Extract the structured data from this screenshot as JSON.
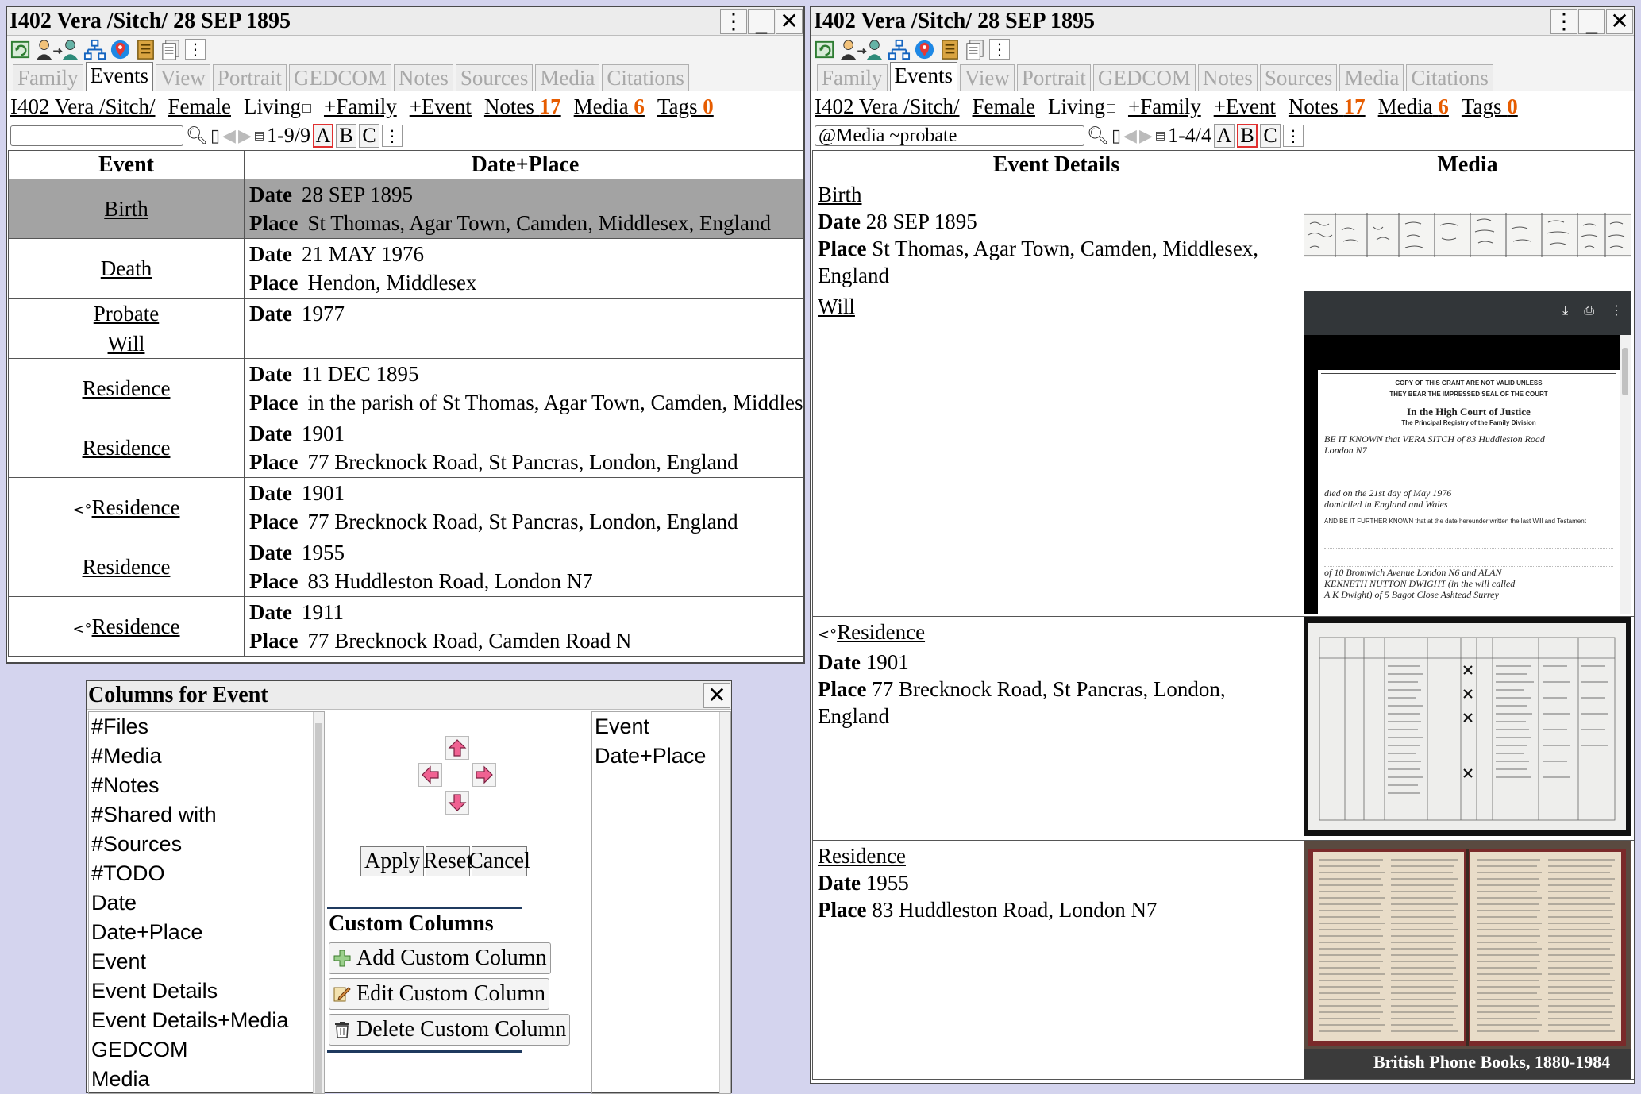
{
  "left": {
    "title": "I402 Vera /Sitch/ 28 SEP 1895",
    "tabs": [
      "Family",
      "Events",
      "View",
      "Portrait",
      "GEDCOM",
      "Notes",
      "Sources",
      "Media",
      "Citations"
    ],
    "info": {
      "name": "I402 Vera /Sitch/",
      "sex": "Female",
      "living": "Living",
      "add_family": "+Family",
      "add_event": "+Event",
      "notes_label": "Notes",
      "notes_count": "17",
      "media_label": "Media",
      "media_count": "6",
      "tags_label": "Tags",
      "tags_count": "0"
    },
    "search": {
      "value": "",
      "range": "1-9/9"
    },
    "columns": [
      "Event",
      "Date+Place"
    ],
    "rows": [
      {
        "event": "Birth",
        "shared": false,
        "date": "28 SEP 1895",
        "place": "St Thomas, Agar Town, Camden, Middlesex, England"
      },
      {
        "event": "Death",
        "shared": false,
        "date": "21 MAY 1976",
        "place": "Hendon, Middlesex"
      },
      {
        "event": "Probate",
        "shared": false,
        "date": "1977",
        "place": ""
      },
      {
        "event": "Will",
        "shared": false,
        "date": "",
        "place": ""
      },
      {
        "event": "Residence",
        "shared": false,
        "date": "11 DEC 1895",
        "place": "in the parish of St Thomas, Agar Town, Camden, Middlesex"
      },
      {
        "event": "Residence",
        "shared": false,
        "date": "1901",
        "place": "77 Brecknock Road, St Pancras, London, England"
      },
      {
        "event": "Residence",
        "shared": true,
        "date": "1901",
        "place": "77 Brecknock Road, St Pancras, London, England"
      },
      {
        "event": "Residence",
        "shared": false,
        "date": "1955",
        "place": "83 Huddleston Road, London N7"
      },
      {
        "event": "Residence",
        "shared": true,
        "date": "1911",
        "place": "77 Brecknock Road, Camden Road N"
      }
    ]
  },
  "right": {
    "title": "I402 Vera /Sitch/ 28 SEP 1895",
    "search": {
      "value": "@Media ~probate",
      "range": "1-4/4"
    },
    "columns": [
      "Event Details",
      "Media"
    ],
    "date_label": "Date",
    "place_label": "Place",
    "rows": [
      {
        "event": "Birth",
        "shared": false,
        "date": "28 SEP 1895",
        "place": "St Thomas, Agar Town, Camden, Middlesex, England",
        "media": "birth-register-scan"
      },
      {
        "event": "Will",
        "shared": false,
        "date": "",
        "place": "",
        "media": "probate-grant-pdf"
      },
      {
        "event": "Residence",
        "shared": true,
        "date": "1901",
        "place": "77 Brecknock Road, St Pancras, London, England",
        "media": "census-1901-scan"
      },
      {
        "event": "Residence",
        "shared": false,
        "date": "1955",
        "place": "83 Huddleston Road, London N7",
        "media": "phone-book-scan"
      }
    ],
    "probate_doc": {
      "header1": "COPY OF THIS GRANT ARE NOT VALID UNLESS",
      "header2": "THEY BEAR THE IMPRESSED SEAL OF THE COURT",
      "court": "In the High Court of Justice",
      "registry": "The Principal Registry of the Family Division",
      "line1": "BE IT KNOWN that VERA SITCH of 83 Huddleston Road",
      "line2": "London N7",
      "died_on": "died on the  21st day of May  1976",
      "domiciled": "domiciled in  England and Wales",
      "further": "AND BE IT FURTHER KNOWN that at the date hereunder written the last Will and Testament",
      "exec1": "of 10 Bromwich Avenue London N6 and ALAN",
      "exec2": "KENNETH NUTTON DWIGHT (in the will called",
      "exec3": "A K Dwight) of 5 Bagot Close Ashtead Surrey"
    },
    "phonebook_caption": "British Phone Books, 1880-1984"
  },
  "dialog": {
    "title": "Columns for Event",
    "available": [
      "#Files",
      "#Media",
      "#Notes",
      "#Shared with",
      "#Sources",
      "#TODO",
      "Date",
      "Date+Place",
      "Event",
      "Event Details",
      "Event Details+Media",
      "GEDCOM",
      "Media"
    ],
    "selected": [
      "Event",
      "Date+Place"
    ],
    "apply": "Apply",
    "reset": "Reset",
    "cancel": "Cancel",
    "custom_heading": "Custom Columns",
    "add_custom": "Add Custom Column",
    "edit_custom": "Edit Custom Column",
    "delete_custom": "Delete Custom Column"
  },
  "colors": {
    "background": "#d4d4ee",
    "count_accent": "#e65c00",
    "selected_row": "#a3a3a3",
    "arrow_pink": "#f06292",
    "sort_selected_border": "#e03030"
  }
}
